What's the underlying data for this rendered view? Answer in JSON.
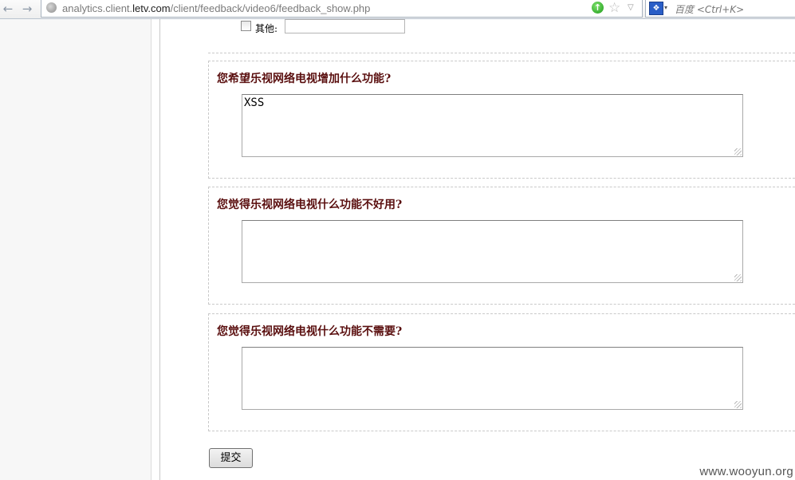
{
  "browser": {
    "url_prefix": "analytics.client.",
    "url_domain": "letv.com",
    "url_path": "/client/feedback/video6/feedback_show.php",
    "search_placeholder": "百度 <Ctrl+K>"
  },
  "form": {
    "other_label": "其他:",
    "other_value": "",
    "questions": [
      {
        "title": "您希望乐视网络电视增加什么功能?",
        "answer": "XSS"
      },
      {
        "title": "您觉得乐视网络电视什么功能不好用?",
        "answer": ""
      },
      {
        "title": "您觉得乐视网络电视什么功能不需要?",
        "answer": ""
      }
    ],
    "submit_label": "提交"
  },
  "watermark": "www.wooyun.org"
}
